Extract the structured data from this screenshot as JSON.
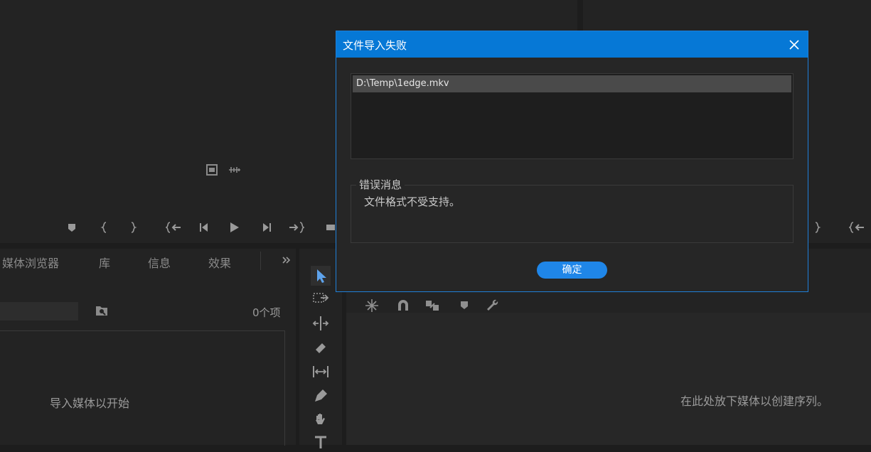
{
  "source_monitor": {
    "controls": [
      "marker-icon",
      "mark-in-icon",
      "mark-out-icon",
      "go-to-in-icon",
      "step-back-icon",
      "play-icon",
      "step-forward-icon",
      "go-to-out-icon",
      "insert-icon"
    ]
  },
  "program_monitor": {
    "controls": [
      "mark-out-icon",
      "go-to-in-icon"
    ]
  },
  "project_panel": {
    "tabs": [
      "媒体浏览器",
      "库",
      "信息",
      "效果"
    ],
    "item_count": "0个项",
    "empty_message": "导入媒体以开始"
  },
  "timeline": {
    "empty_message": "在此处放下媒体以创建序列。"
  },
  "dialog": {
    "title": "文件导入失败",
    "files": [
      "D:\\Temp\\1edge.mkv"
    ],
    "error_group_label": "错误消息",
    "error_message": "文件格式不受支持。",
    "ok_label": "确定"
  },
  "colors": {
    "accent": "#0678d6",
    "button": "#1f86e8",
    "panel": "#232323",
    "background": "#1d1d1d"
  }
}
